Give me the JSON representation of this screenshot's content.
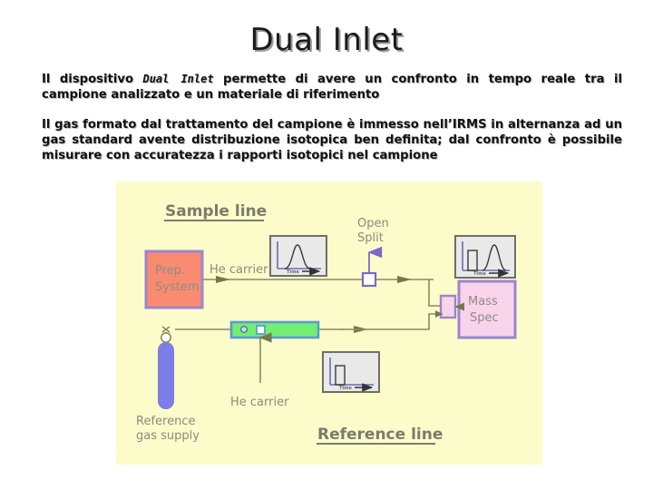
{
  "slide": {
    "title": "Dual Inlet",
    "paragraphs": [
      {
        "id": "para-1",
        "before": "Il dispositivo ",
        "emphasis": "Dual Inlet",
        "after": " permette di avere un confronto in tempo reale tra il campione analizzato e un materiale di riferimento"
      },
      {
        "id": "para-2",
        "before": "",
        "emphasis": "",
        "after": "Il gas formato dal trattamento del campione è immesso nell’IRMS in alternanza ad un gas standard avente distribuzione isotopica ben definita; dal confronto è possibile misurare con accuratezza i rapporti isotopici nel campione"
      }
    ]
  },
  "diagram": {
    "background_color": "#fcfcca",
    "labels": {
      "sample_line": "Sample line",
      "reference_line": "Reference line",
      "open_split": "Open",
      "open_split_2": "Split",
      "he_carrier_top": "He carrier",
      "he_carrier_bottom": "He carrier",
      "reference_gas_supply": "Reference",
      "reference_gas_supply_2": "gas supply",
      "time_axis": "Time"
    },
    "boxes": [
      {
        "name": "prep-system",
        "line1": "Prep.",
        "line2": "System",
        "fill": "#f98b70",
        "stroke": "#9b85d0"
      },
      {
        "name": "mass-spec",
        "line1": "Mass",
        "line2": "Spec",
        "fill": "#f9d3ea",
        "stroke": "#9b85d0"
      }
    ],
    "components": [
      {
        "name": "reference-gas-cylinder",
        "fill": "#7b7de8"
      },
      {
        "name": "capillary-bar",
        "fill": "#72ef72",
        "stroke": "#5a9bd0"
      },
      {
        "name": "open-split-valve",
        "fill": "#ffffff",
        "stroke": "#7a68c8"
      },
      {
        "name": "changeover-valve",
        "fill": "#f9d3ea",
        "stroke": "#9b85d0"
      }
    ],
    "chromatograms": [
      {
        "name": "chromatogram-sample-top",
        "trace": "peak"
      },
      {
        "name": "chromatogram-combined",
        "trace": "block-and-peak"
      },
      {
        "name": "chromatogram-reference",
        "trace": "block"
      }
    ],
    "colors": {
      "line": "#8a8a5e",
      "label_gray": "#8a8a80",
      "heading_gray": "#7b7b6e"
    }
  }
}
